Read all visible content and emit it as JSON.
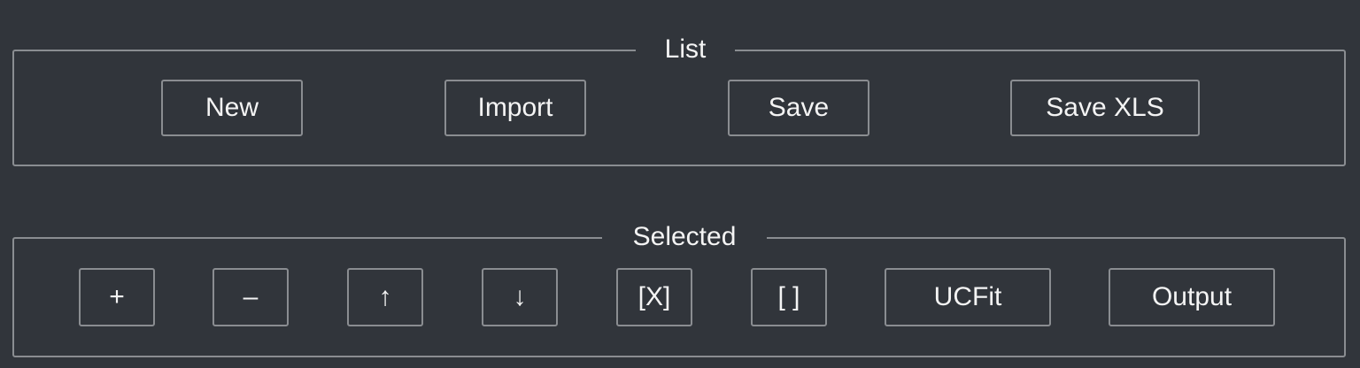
{
  "list": {
    "title": "List",
    "buttons": {
      "new": "New",
      "import": "Import",
      "save": "Save",
      "save_xls": "Save XLS"
    }
  },
  "selected": {
    "title": "Selected",
    "buttons": {
      "add": "+",
      "remove": "–",
      "move_up": "↑",
      "move_down": "↓",
      "check": "[X]",
      "uncheck": "[ ]",
      "ucfit": "UCFit",
      "output": "Output"
    }
  }
}
